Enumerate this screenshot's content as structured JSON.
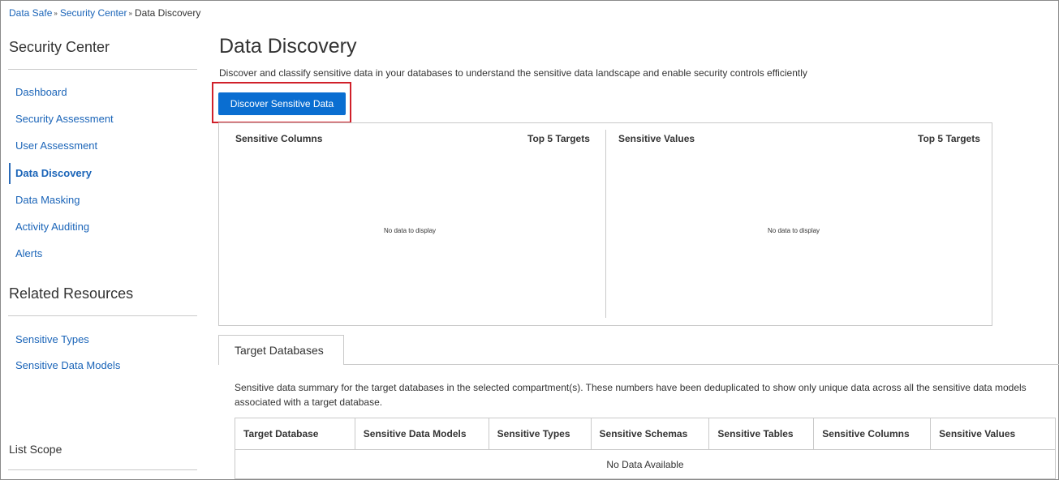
{
  "breadcrumb": {
    "items": [
      "Data Safe",
      "Security Center",
      "Data Discovery"
    ],
    "separator": "»"
  },
  "sidebar": {
    "heading": "Security Center",
    "items": [
      {
        "label": "Dashboard",
        "active": false
      },
      {
        "label": "Security Assessment",
        "active": false
      },
      {
        "label": "User Assessment",
        "active": false
      },
      {
        "label": "Data Discovery",
        "active": true
      },
      {
        "label": "Data Masking",
        "active": false
      },
      {
        "label": "Activity Auditing",
        "active": false
      },
      {
        "label": "Alerts",
        "active": false
      }
    ],
    "related_heading": "Related Resources",
    "related_items": [
      {
        "label": "Sensitive Types"
      },
      {
        "label": "Sensitive Data Models"
      }
    ],
    "scope_heading": "List Scope"
  },
  "main": {
    "title": "Data Discovery",
    "description": "Discover and classify sensitive data in your databases to understand the sensitive data landscape and enable security controls efficiently",
    "discover_button": "Discover Sensitive Data",
    "charts": [
      {
        "title": "Sensitive Columns",
        "subtitle": "Top 5 Targets",
        "empty": "No data to display"
      },
      {
        "title": "Sensitive Values",
        "subtitle": "Top 5 Targets",
        "empty": "No data to display"
      }
    ],
    "tab": "Target Databases",
    "tab_description": "Sensitive data summary for the target databases in the selected compartment(s). These numbers have been deduplicated to show only unique data across all the sensitive data models associated with a target database.",
    "table": {
      "columns": [
        "Target Database",
        "Sensitive Data Models",
        "Sensitive Types",
        "Sensitive Schemas",
        "Sensitive Tables",
        "Sensitive Columns",
        "Sensitive Values"
      ],
      "empty": "No Data Available"
    }
  },
  "colors": {
    "link": "#1a64b8",
    "primary": "#0a6ed1",
    "highlight": "#d0202a",
    "border": "#c9c9c9"
  }
}
